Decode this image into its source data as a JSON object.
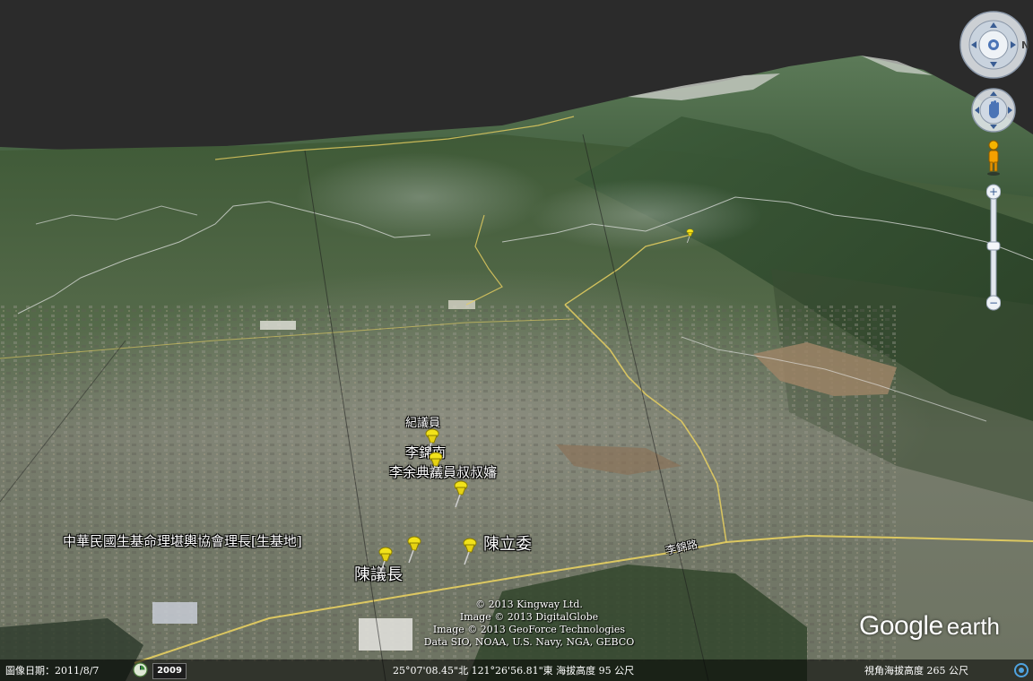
{
  "placemarks": {
    "ji_councilor": "紀議員",
    "li_jinnan": "李錦南",
    "li_yudian": "李余典議員叔叔嬸",
    "association": "中華民國生基命理堪輿協會理長[生基地]",
    "chen_legislator": "陳立委",
    "chen_speaker": "陳議長"
  },
  "road_label": "李錦路",
  "attribution": {
    "line1": "© 2013 Kingway Ltd.",
    "line2": "Image © 2013 DigitalGlobe",
    "line3": "Image © 2013 GeoForce Technologies",
    "line4": "Data SIO, NOAA, U.S. Navy, NGA, GEBCO"
  },
  "logo": {
    "google": "Google",
    "earth": "earth"
  },
  "status": {
    "imagery_date": "圖像日期：2011/8/7",
    "history_year": "2009",
    "coordinates": "25°07'08.45\"北  121°26'56.81\"東  海拔高度    95 公尺",
    "eye_altitude": "視角海拔高度      265 公尺"
  },
  "controls": {
    "north_label": "N",
    "zoom_in": "+",
    "zoom_out": "−"
  },
  "colors": {
    "sky": "#2b2b2b",
    "pin_yellow": "#f2e21a",
    "road_yellow": "#e8d060",
    "border_white": "#e8e8e8"
  }
}
